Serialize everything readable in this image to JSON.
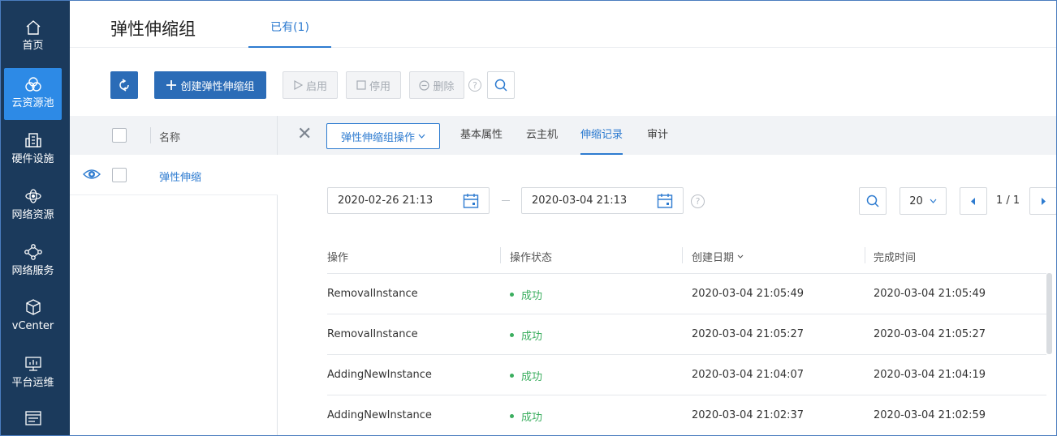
{
  "sidebar": {
    "items": [
      {
        "label": "首页",
        "icon": "home-icon"
      },
      {
        "label": "云资源池",
        "icon": "cloud-pool-icon"
      },
      {
        "label": "硬件设施",
        "icon": "building-icon"
      },
      {
        "label": "网络资源",
        "icon": "network-resource-icon"
      },
      {
        "label": "网络服务",
        "icon": "network-service-icon"
      },
      {
        "label": "vCenter",
        "icon": "cube-icon"
      },
      {
        "label": "平台运维",
        "icon": "monitor-icon"
      },
      {
        "label": "",
        "icon": "list-icon"
      }
    ],
    "active_index": 1,
    "colors": {
      "background": "#1b3a5c",
      "active": "#2d8ae6"
    }
  },
  "header": {
    "title": "弹性伸缩组",
    "tab_existing": "已有(1)"
  },
  "toolbar": {
    "refresh": "refresh-icon",
    "create": "创建弹性伸缩组",
    "start": "启用",
    "stop": "停用",
    "delete": "删除",
    "help": "?"
  },
  "list": {
    "header_name": "名称",
    "rows": [
      {
        "name": "弹性伸缩"
      }
    ]
  },
  "detail": {
    "ops_dropdown": "弹性伸缩组操作",
    "tabs": [
      "基本属性",
      "云主机",
      "伸缩记录",
      "审计"
    ],
    "active_tab": 2
  },
  "filter": {
    "start_date": "2020-02-26 21:13",
    "end_date": "2020-03-04 21:13",
    "help": "?",
    "page_size": "20",
    "pager": "1 / 1"
  },
  "table": {
    "headers": [
      "操作",
      "操作状态",
      "创建日期",
      "完成时间"
    ],
    "rows": [
      {
        "op": "RemovalInstance",
        "status": "成功",
        "created": "2020-03-04 21:05:49",
        "finished": "2020-03-04 21:05:49"
      },
      {
        "op": "RemovalInstance",
        "status": "成功",
        "created": "2020-03-04 21:05:27",
        "finished": "2020-03-04 21:05:27"
      },
      {
        "op": "AddingNewInstance",
        "status": "成功",
        "created": "2020-03-04 21:04:07",
        "finished": "2020-03-04 21:04:19"
      },
      {
        "op": "AddingNewInstance",
        "status": "成功",
        "created": "2020-03-04 21:02:37",
        "finished": "2020-03-04 21:02:59"
      }
    ],
    "status_color": "#3bae5f"
  }
}
